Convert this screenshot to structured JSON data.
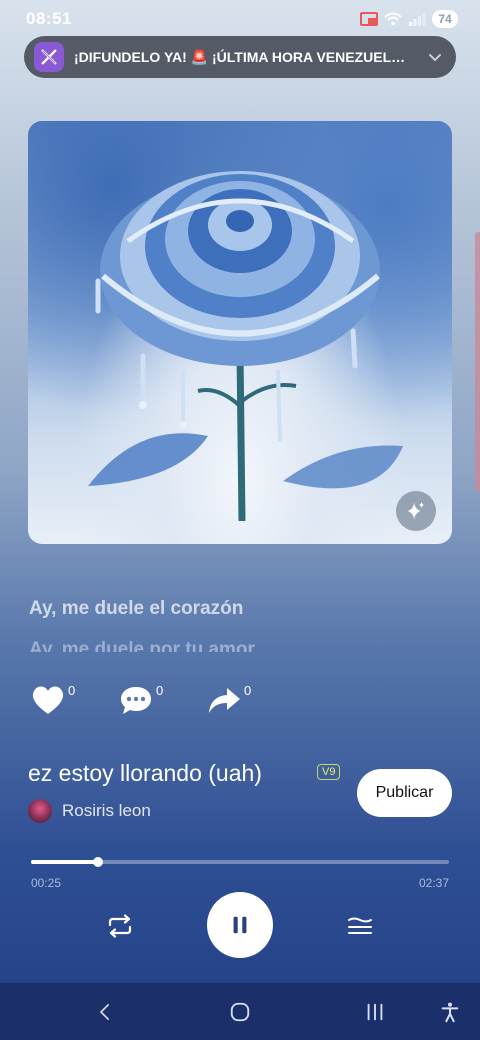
{
  "status_bar": {
    "time": "08:51",
    "battery": "74"
  },
  "notification": {
    "app_icon": "x-logo-icon",
    "text": "¡DIFUNDELO YA! 🚨 ¡ÚLTIMA HORA VENEZUEL…"
  },
  "cover": {
    "alt_icon": "sparkle-icon"
  },
  "lyrics": {
    "current": "Ay, me duele el corazón",
    "next": "Ay, me duele por tu amor"
  },
  "actions": {
    "likes": "0",
    "comments": "0",
    "shares": "0"
  },
  "song": {
    "title": "ez estoy llorando (uah)",
    "version": "V9",
    "artist": "Rosiris leon"
  },
  "publish_label": "Publicar",
  "player": {
    "current_time": "00:25",
    "total_time": "02:37",
    "progress": 0.16
  },
  "colors": {
    "accent_badge": "#e8f06a",
    "nav_bg": "#1b2f6a"
  }
}
